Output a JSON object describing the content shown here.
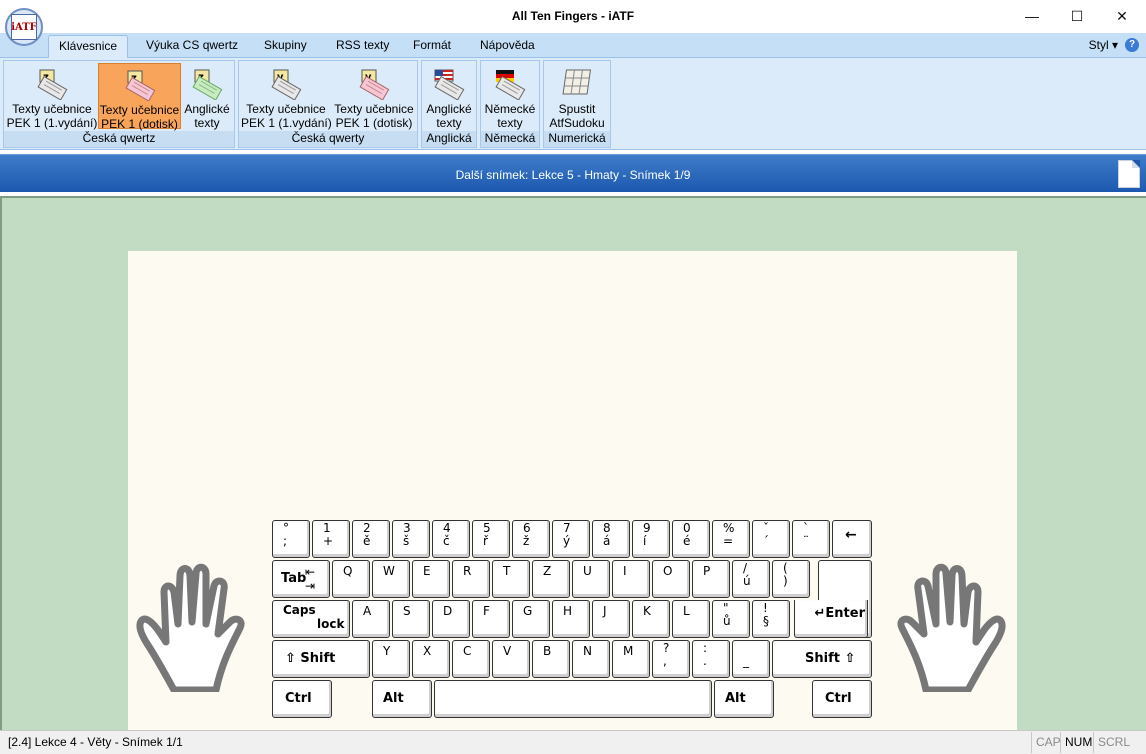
{
  "window": {
    "title": "All Ten Fingers - iATF",
    "app_icon_text": "iATF",
    "minimize": "—",
    "maximize": "☐",
    "close": "✕"
  },
  "tabs": [
    {
      "label": "Klávesnice",
      "active": true
    },
    {
      "label": "Výuka CS qwertz"
    },
    {
      "label": "Skupiny"
    },
    {
      "label": "RSS texty"
    },
    {
      "label": "Formát"
    },
    {
      "label": "Nápověda"
    }
  ],
  "style_menu": "Styl",
  "groups": [
    {
      "label": "Česká qwertz",
      "buttons": [
        {
          "label1": "Texty učebnice",
          "label2": "PEK 1 (1.vydání)",
          "icon": "keyboard-z-icon"
        },
        {
          "label1": "Texty učebnice",
          "label2": "PEK 1 (dotisk)",
          "icon": "keyboard-z-pink-icon",
          "active": true
        },
        {
          "label1": "Anglické",
          "label2": "texty",
          "icon": "keyboard-z-green-icon"
        }
      ]
    },
    {
      "label": "Česká qwerty",
      "buttons": [
        {
          "label1": "Texty učebnice",
          "label2": "PEK 1 (1.vydání)",
          "icon": "keyboard-y-icon"
        },
        {
          "label1": "Texty učebnice",
          "label2": "PEK 1 (dotisk)",
          "icon": "keyboard-y-pink-icon"
        }
      ]
    },
    {
      "label": "Anglická",
      "buttons": [
        {
          "label1": "Anglické",
          "label2": "texty",
          "icon": "us-flag-keyboard-icon"
        }
      ]
    },
    {
      "label": "Německá",
      "buttons": [
        {
          "label1": "Německé",
          "label2": "texty",
          "icon": "de-flag-keyboard-icon"
        }
      ]
    },
    {
      "label": "Numerická",
      "buttons": [
        {
          "label1": "Spustit",
          "label2": "AtfSudoku",
          "icon": "sudoku-grid-icon"
        }
      ]
    }
  ],
  "next_slide": "Další snímek: Lekce 5 - Hmaty - Snímek 1/9",
  "keyboard": {
    "row1": [
      {
        "t": "°",
        "b": ";"
      },
      {
        "t": "1",
        "b": "+"
      },
      {
        "t": "2",
        "b": "ě"
      },
      {
        "t": "3",
        "b": "š"
      },
      {
        "t": "4",
        "b": "č"
      },
      {
        "t": "5",
        "b": "ř"
      },
      {
        "t": "6",
        "b": "ž"
      },
      {
        "t": "7",
        "b": "ý"
      },
      {
        "t": "8",
        "b": "á"
      },
      {
        "t": "9",
        "b": "í"
      },
      {
        "t": "0",
        "b": "é"
      },
      {
        "t": "%",
        "b": "="
      },
      {
        "t": "ˇ",
        "b": "´"
      },
      {
        "t": "`",
        "b": "¨"
      },
      {
        "w": "←"
      }
    ],
    "row2": [
      "Q",
      "W",
      "E",
      "R",
      "T",
      "Z",
      "U",
      "I",
      "O",
      "P"
    ],
    "row2_extra": [
      {
        "t": "/",
        "b": "ú"
      },
      {
        "t": "(",
        "b": ")"
      }
    ],
    "tab": "Tab",
    "row3": [
      "A",
      "S",
      "D",
      "F",
      "G",
      "H",
      "J",
      "K",
      "L"
    ],
    "row3_extra": [
      {
        "t": "\"",
        "b": "ů"
      },
      {
        "t": "!",
        "b": "§"
      }
    ],
    "caps1": "Caps",
    "caps2": "lock",
    "enter": "↵Enter",
    "row4": [
      "Y",
      "X",
      "C",
      "V",
      "B",
      "N",
      "M"
    ],
    "row4_extra": [
      {
        "t": "?",
        "b": ","
      },
      {
        "t": ":",
        "b": "."
      },
      {
        "t": "",
        "b": "_"
      }
    ],
    "shift_left": "⇧ Shift",
    "shift_right": "Shift ⇧",
    "ctrl": "Ctrl",
    "alt": "Alt"
  },
  "status": {
    "text": "[2.4]  Lekce 4 - Věty - Snímek 1/1",
    "cap": "CAP",
    "num": "NUM",
    "scrl": "SCRL"
  },
  "colors": {
    "ribbon_bg": "#dcebf9",
    "active_button": "#f8a45a",
    "next_bar": "#2a66b8",
    "main_bg": "#c1dcc3",
    "paper": "#fdfaf1"
  }
}
